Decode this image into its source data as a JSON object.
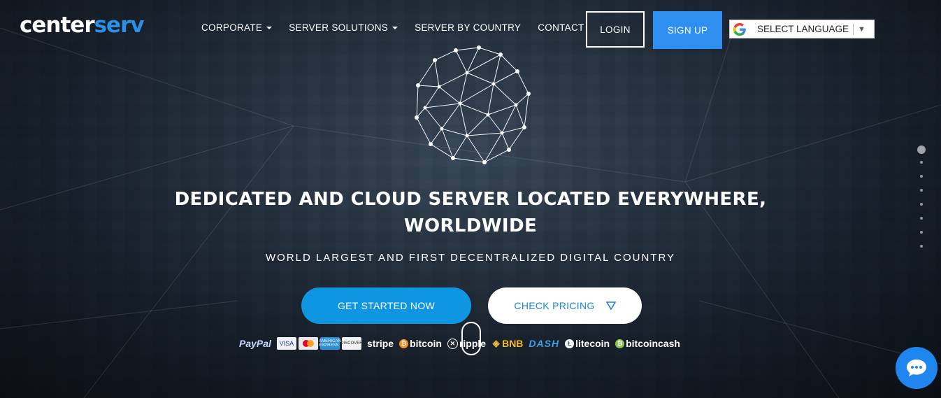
{
  "brand": {
    "logo_part1": "center",
    "logo_part2": "serv",
    "accent": "#2f8ff0"
  },
  "nav": {
    "items": [
      {
        "label": "CORPORATE",
        "has_dropdown": true
      },
      {
        "label": "SERVER SOLUTIONS",
        "has_dropdown": true
      },
      {
        "label": "SERVER BY COUNTRY",
        "has_dropdown": false
      },
      {
        "label": "CONTACT",
        "has_dropdown": false
      }
    ],
    "login_label": "LOGIN",
    "signup_label": "SIGN UP",
    "language_label": "SELECT LANGUAGE",
    "language_arrow": "▼"
  },
  "hero": {
    "headline_line1": "DEDICATED AND CLOUD SERVER LOCATED EVERYWHERE,",
    "headline_line2": "WORLDWIDE",
    "subheadline": "WORLD LARGEST AND FIRST DECENTRALIZED DIGITAL COUNTRY",
    "cta_primary": "GET STARTED NOW",
    "cta_secondary": "CHECK PRICING"
  },
  "payments": {
    "paypal": "PayPal",
    "visa": "VISA",
    "amex": "AMERICAN EXPRESS",
    "discover": "DISCOVER",
    "stripe": "stripe",
    "bitcoin": "bitcoin",
    "ripple": "ripple",
    "bnb": "BNB",
    "dash": "DASH",
    "litecoin": "litecoin",
    "bitcoincash": "bitcoincash"
  },
  "icons": {
    "globe": "network-globe-icon",
    "google": "google-icon",
    "chat": "chat-bubble-icon",
    "pricing_arrow": "triangle-down-icon"
  },
  "slider": {
    "count": 8,
    "active_index": 0
  }
}
